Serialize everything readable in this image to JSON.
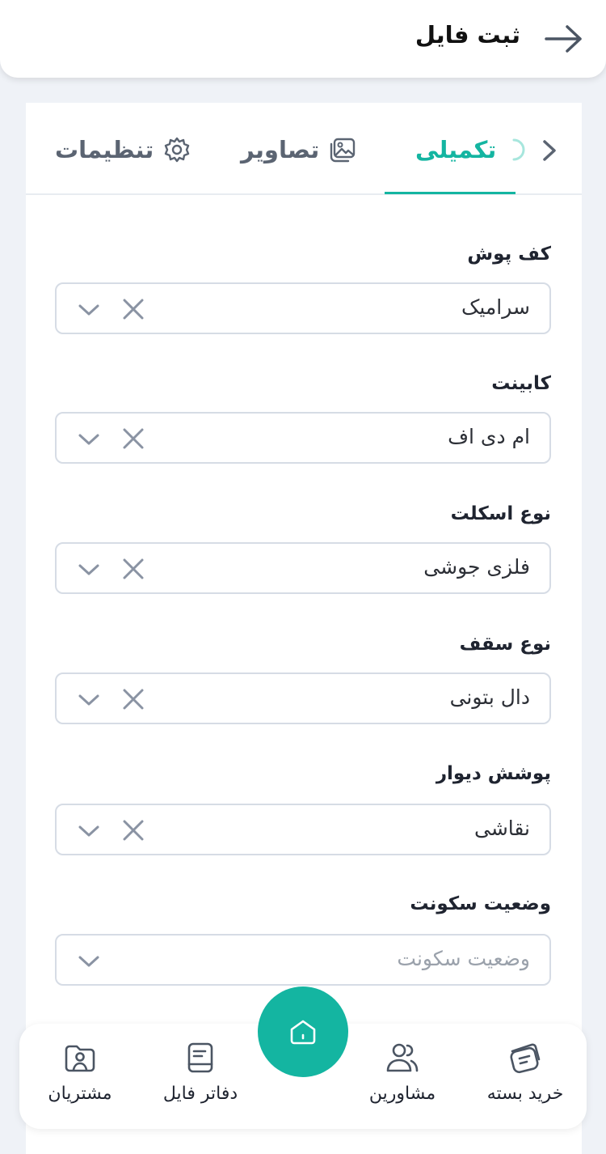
{
  "header": {
    "title": "ثبت فایل",
    "back_icon": "arrow-right-icon"
  },
  "tabs": [
    {
      "label": "تنظیمات",
      "icon": "gear-icon",
      "active": false
    },
    {
      "label": "تصاویر",
      "icon": "image-icon",
      "active": false
    },
    {
      "label": "تکمیلی",
      "icon": "circle-progress-icon",
      "active": true
    }
  ],
  "fields": [
    {
      "label": "کف پوش",
      "value": "سرامیک",
      "placeholder": ""
    },
    {
      "label": "کابینت",
      "value": "ام دی اف",
      "placeholder": ""
    },
    {
      "label": "نوع اسکلت",
      "value": "فلزی جوشی",
      "placeholder": ""
    },
    {
      "label": "نوع سقف",
      "value": "دال بتونی",
      "placeholder": ""
    },
    {
      "label": "پوشش دیوار",
      "value": "نقاشی",
      "placeholder": ""
    },
    {
      "label": "وضعیت سکونت",
      "value": "",
      "placeholder": "وضعیت سکونت"
    }
  ],
  "bottom_nav": {
    "items": [
      {
        "label": "مشتریان",
        "icon": "folder-user-icon"
      },
      {
        "label": "دفاتر فایل",
        "icon": "notebook-icon"
      },
      {
        "label": "مشاورین",
        "icon": "users-icon"
      },
      {
        "label": "خرید بسته",
        "icon": "ticket-icon"
      }
    ],
    "home_icon": "home-icon"
  },
  "colors": {
    "accent": "#14b5a1",
    "background": "#eff2f7",
    "border": "#d6dce5"
  }
}
